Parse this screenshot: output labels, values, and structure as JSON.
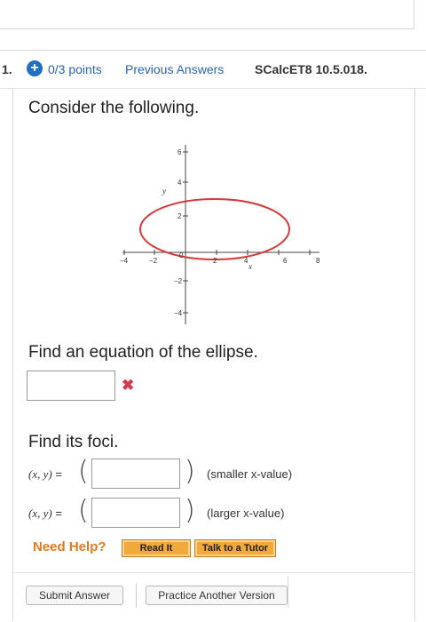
{
  "question": {
    "number": "1.",
    "points": "0/3 points",
    "previous_answers": "Previous Answers",
    "code": "SCalcET8 10.5.018.",
    "prompt": "Consider the following."
  },
  "graph": {
    "y_axis_label": "y",
    "x_axis_label": "x",
    "x_ticks": [
      "−4",
      "−2",
      "0",
      "2",
      "4",
      "6",
      "8"
    ],
    "y_ticks": [
      "6",
      "4",
      "2",
      "−2",
      "−4"
    ],
    "ellipse_color": "#d63a3a"
  },
  "part1": {
    "prompt": "Find an equation of the ellipse.",
    "answer_value": "",
    "status_icon": "✖",
    "status_color": "#d5394f"
  },
  "part2": {
    "prompt": "Find its foci.",
    "rows": [
      {
        "label_vars": "(x, y)",
        "eq": "=",
        "value": "",
        "note": "(smaller x-value)"
      },
      {
        "label_vars": "(x, y)",
        "eq": "=",
        "value": "",
        "note": "(larger x-value)"
      }
    ]
  },
  "help": {
    "label": "Need Help?",
    "read_it": "Read It",
    "talk_to_tutor": "Talk to a Tutor"
  },
  "actions": {
    "submit": "Submit Answer",
    "practice": "Practice Another Version"
  }
}
